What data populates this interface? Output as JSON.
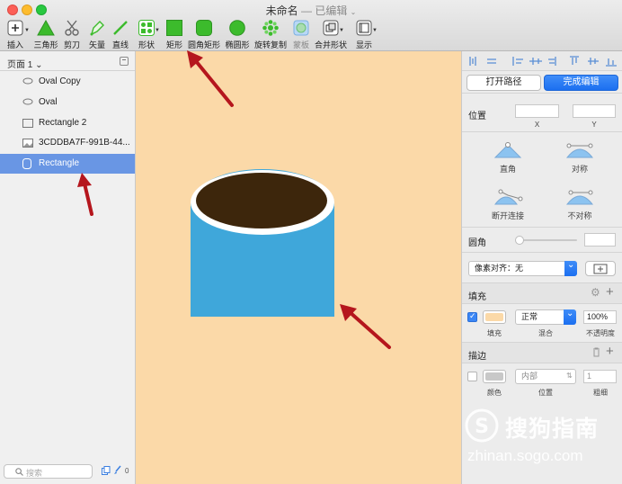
{
  "window": {
    "title": "未命名",
    "subtitle": "— 已编辑"
  },
  "toolbar": {
    "items": [
      {
        "label": "插入"
      },
      {
        "label": "三角形"
      },
      {
        "label": "剪刀"
      },
      {
        "label": "矢量"
      },
      {
        "label": "直线"
      },
      {
        "label": "形状"
      },
      {
        "label": "矩形"
      },
      {
        "label": "圆角矩形"
      },
      {
        "label": "椭圆形"
      },
      {
        "label": "旋转复制"
      },
      {
        "label": "蒙板"
      },
      {
        "label": "合并形状"
      },
      {
        "label": "显示"
      }
    ]
  },
  "sidebar": {
    "page_label": "页面 1",
    "layers": [
      {
        "name": "Oval Copy",
        "icon": "oval-icon",
        "selected": false
      },
      {
        "name": "Oval",
        "icon": "oval-icon",
        "selected": false
      },
      {
        "name": "Rectangle 2",
        "icon": "rectangle-icon",
        "selected": false
      },
      {
        "name": "3CDDBA7F-991B-44...",
        "icon": "image-icon",
        "selected": false
      },
      {
        "name": "Rectangle",
        "icon": "rounded-rect-icon",
        "selected": true
      }
    ],
    "search_placeholder": "搜索",
    "count_badge": "0"
  },
  "canvas": {
    "background": "#fbd9a8",
    "rect_fill": "#3fa7da",
    "oval_fill": "#3d260c",
    "oval_ring": "#ffffff",
    "arrow_color": "#b5161d"
  },
  "inspector": {
    "open_path": "打开路径",
    "done_edit": "完成编辑",
    "position_label": "位置",
    "x_label": "X",
    "y_label": "Y",
    "vertex_modes": [
      "直角",
      "对称",
      "断开连接",
      "不对称"
    ],
    "corner_label": "圆角",
    "pixel_align": "像素对齐：无",
    "fill": {
      "title": "填充",
      "color": "#fbd9a8",
      "blend": "正常",
      "opacity": "100%",
      "caption_fill": "填充",
      "caption_blend": "混合",
      "caption_opacity": "不透明度"
    },
    "border": {
      "title": "描边",
      "color": "#c8c8c8",
      "position": "内部",
      "width": "1",
      "caption_color": "颜色",
      "caption_position": "位置",
      "caption_width": "粗细"
    }
  },
  "watermark": {
    "name": "搜狗指南",
    "url": "zhinan.sogo.com"
  }
}
